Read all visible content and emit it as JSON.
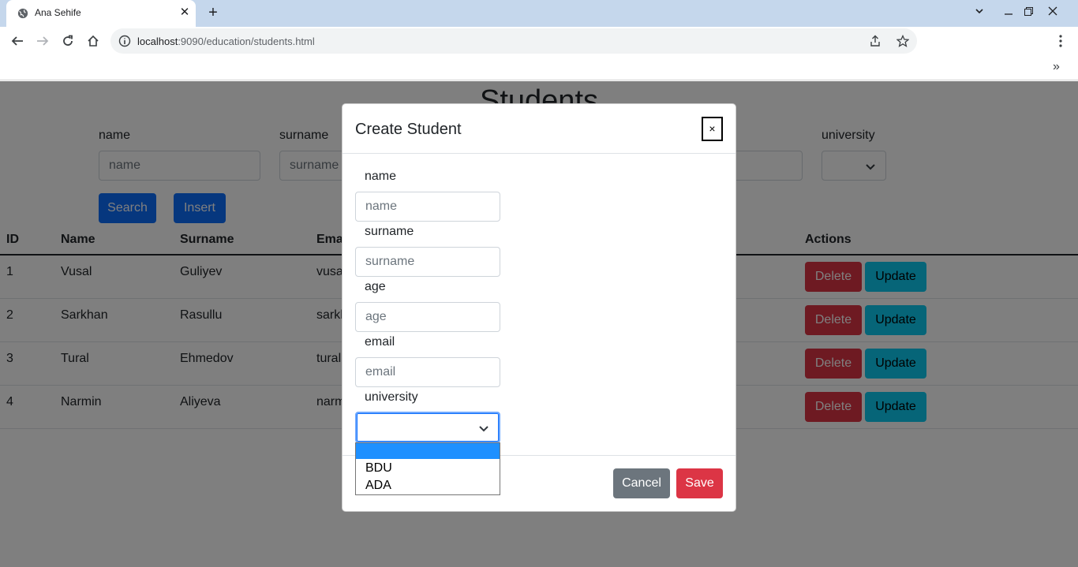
{
  "browser": {
    "tab_title": "Ana Sehife",
    "url_host": "localhost",
    "url_rest": ":9090/education/students.html"
  },
  "page": {
    "title": "Students",
    "filters": {
      "name_label": "name",
      "name_placeholder": "name",
      "surname_label": "surname",
      "surname_placeholder": "surname",
      "university_label": "university"
    },
    "buttons": {
      "search": "Search",
      "insert": "Insert"
    },
    "table": {
      "headers": {
        "id": "ID",
        "name": "Name",
        "surname": "Surname",
        "email": "Email",
        "actions": "Actions"
      },
      "rows": [
        {
          "id": "1",
          "name": "Vusal",
          "surname": "Guliyev",
          "email": "vusal"
        },
        {
          "id": "2",
          "name": "Sarkhan",
          "surname": "Rasullu",
          "email": "sarkh"
        },
        {
          "id": "3",
          "name": "Tural",
          "surname": "Ehmedov",
          "email": "tural"
        },
        {
          "id": "4",
          "name": "Narmin",
          "surname": "Aliyeva",
          "email": "narm"
        }
      ],
      "delete_label": "Delete",
      "update_label": "Update"
    }
  },
  "modal": {
    "title": "Create Student",
    "close": "×",
    "fields": {
      "name_label": "name",
      "name_placeholder": "name",
      "surname_label": "surname",
      "surname_placeholder": "surname",
      "age_label": "age",
      "age_placeholder": "age",
      "email_label": "email",
      "email_placeholder": "email",
      "university_label": "university"
    },
    "university_options": [
      "",
      "BDU",
      "ADA"
    ],
    "cancel": "Cancel",
    "save": "Save"
  },
  "colors": {
    "primary": "#0d6efd",
    "danger": "#dc3545",
    "info": "#0dcaf0",
    "secondary": "#6c757d"
  }
}
